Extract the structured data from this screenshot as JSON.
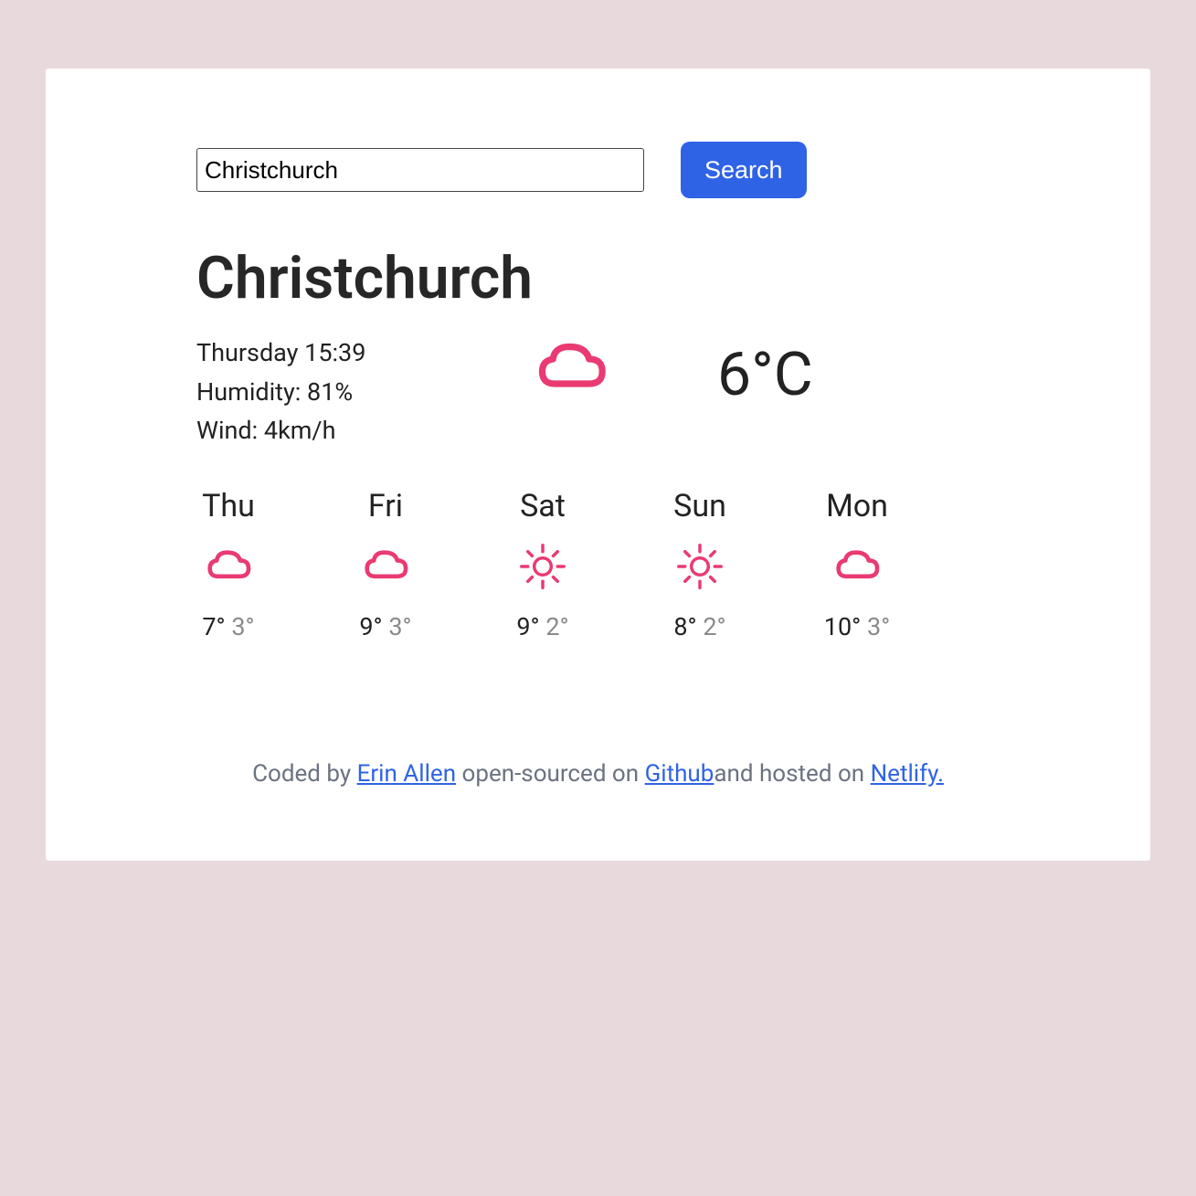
{
  "search": {
    "value": "Christchurch",
    "button_label": "Search"
  },
  "city": "Christchurch",
  "current": {
    "datetime": "Thursday 15:39",
    "humidity_label": "Humidity: 81%",
    "wind_label": "Wind: 4km/h",
    "icon": "cloud",
    "temperature": "6°C"
  },
  "forecast": [
    {
      "day": "Thu",
      "icon": "cloud",
      "high": "7°",
      "low": "3°"
    },
    {
      "day": "Fri",
      "icon": "cloud",
      "high": "9°",
      "low": "3°"
    },
    {
      "day": "Sat",
      "icon": "sun",
      "high": "9°",
      "low": "2°"
    },
    {
      "day": "Sun",
      "icon": "sun",
      "high": "8°",
      "low": "2°"
    },
    {
      "day": "Mon",
      "icon": "cloud",
      "high": "10°",
      "low": "3°"
    }
  ],
  "footer": {
    "prefix": "Coded by ",
    "author": "Erin Allen",
    "mid1": " open-sourced on ",
    "github": "Github",
    "mid2": "and hosted on ",
    "netlify": "Netlify."
  },
  "colors": {
    "accent_pink": "#ea3a72",
    "button_blue": "#2f63e6"
  }
}
